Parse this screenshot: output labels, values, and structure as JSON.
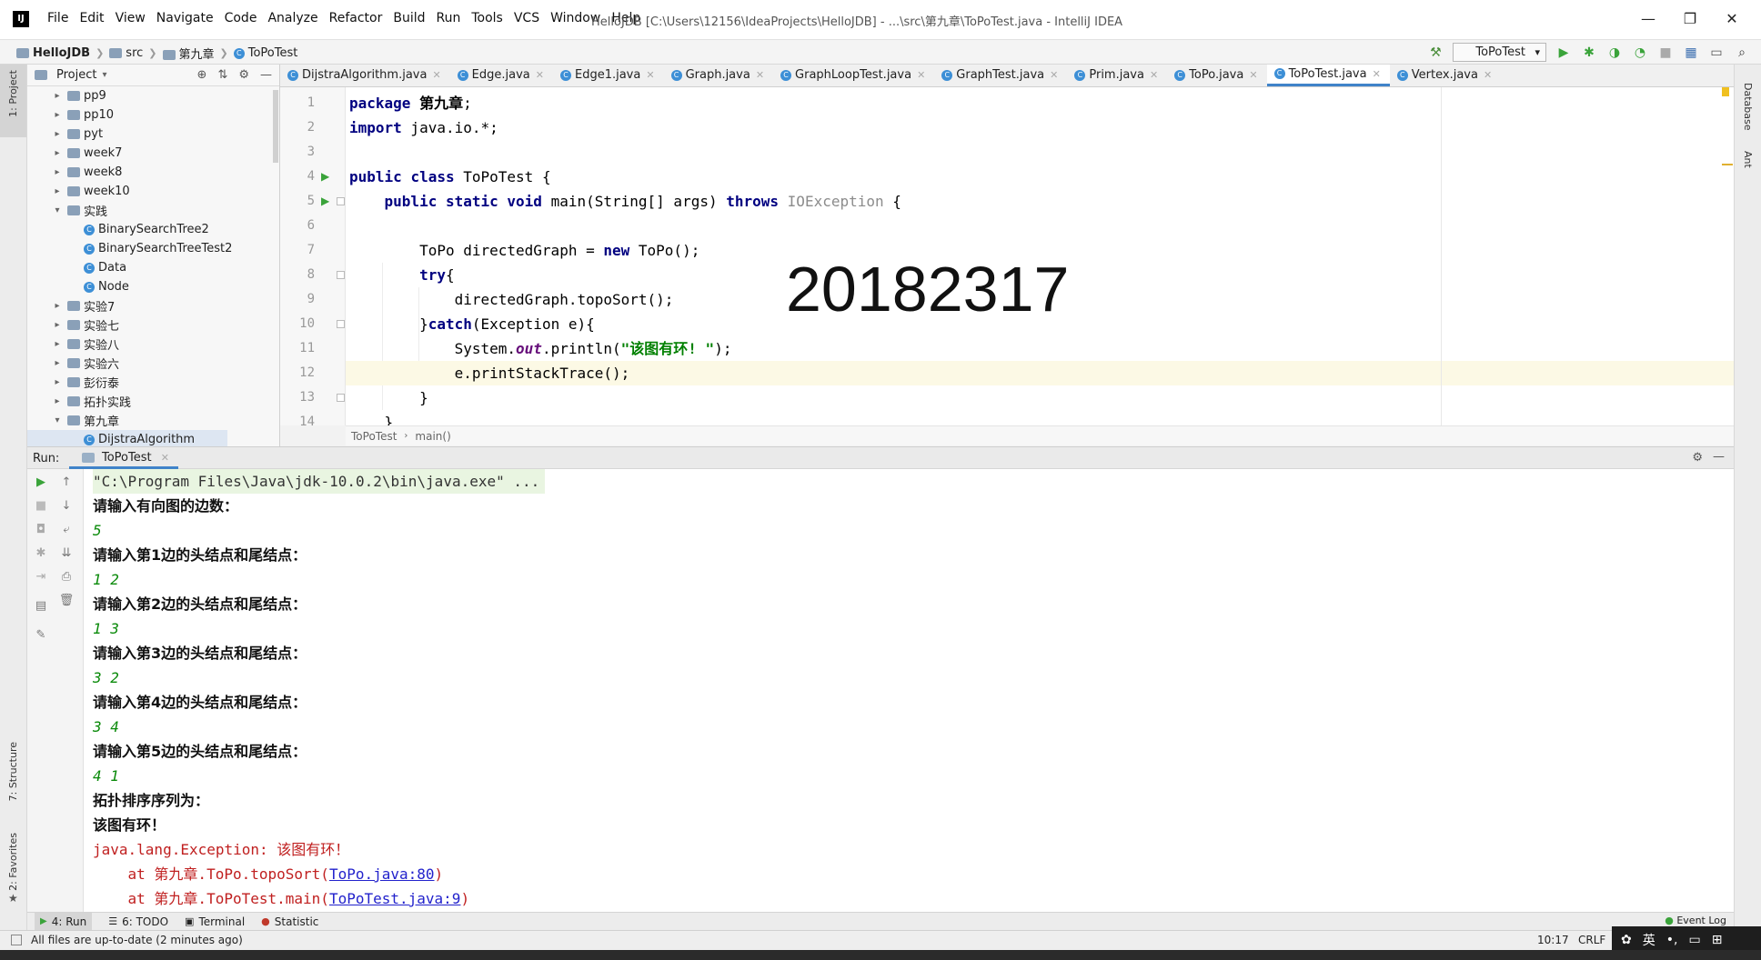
{
  "window": {
    "app_icon": "IJ",
    "title": "HelloJDB [C:\\Users\\12156\\IdeaProjects\\HelloJDB] - ...\\src\\第九章\\ToPoTest.java - IntelliJ IDEA",
    "controls": [
      "—",
      "❐",
      "✕"
    ]
  },
  "menu": [
    "File",
    "Edit",
    "View",
    "Navigate",
    "Code",
    "Analyze",
    "Refactor",
    "Build",
    "Run",
    "Tools",
    "VCS",
    "Window",
    "Help"
  ],
  "nav": {
    "crumbs": [
      "HelloJDB",
      "src",
      "第九章",
      "ToPoTest"
    ],
    "run_config": "ToPoTest"
  },
  "left_strip": {
    "project": "1: Project",
    "structure": "7: Structure",
    "favorites": "2: Favorites"
  },
  "right_strip": {
    "database": "Database",
    "ant": "Ant"
  },
  "project_panel": {
    "title": "Project",
    "items": [
      {
        "label": "pp9",
        "kind": "folder",
        "level": 1,
        "expanded": false
      },
      {
        "label": "pp10",
        "kind": "folder",
        "level": 1,
        "expanded": false
      },
      {
        "label": "pyt",
        "kind": "folder",
        "level": 1,
        "expanded": false
      },
      {
        "label": "week7",
        "kind": "folder",
        "level": 1,
        "expanded": false
      },
      {
        "label": "week8",
        "kind": "folder",
        "level": 1,
        "expanded": false
      },
      {
        "label": "week10",
        "kind": "folder",
        "level": 1,
        "expanded": false
      },
      {
        "label": "实践",
        "kind": "folder",
        "level": 1,
        "expanded": true
      },
      {
        "label": "BinarySearchTree2",
        "kind": "class",
        "level": 2
      },
      {
        "label": "BinarySearchTreeTest2",
        "kind": "class",
        "level": 2
      },
      {
        "label": "Data",
        "kind": "class",
        "level": 2
      },
      {
        "label": "Node",
        "kind": "class",
        "level": 2
      },
      {
        "label": "实验7",
        "kind": "folder",
        "level": 1,
        "expanded": false
      },
      {
        "label": "实验七",
        "kind": "folder",
        "level": 1,
        "expanded": false
      },
      {
        "label": "实验八",
        "kind": "folder",
        "level": 1,
        "expanded": false
      },
      {
        "label": "实验六",
        "kind": "folder",
        "level": 1,
        "expanded": false
      },
      {
        "label": "彭衍泰",
        "kind": "folder",
        "level": 1,
        "expanded": false
      },
      {
        "label": "拓扑实践",
        "kind": "folder",
        "level": 1,
        "expanded": false
      },
      {
        "label": "第九章",
        "kind": "folder",
        "level": 1,
        "expanded": true
      },
      {
        "label": "DijstraAlgorithm",
        "kind": "class",
        "level": 2
      }
    ]
  },
  "editor_tabs": [
    {
      "label": "DijstraAlgorithm.java",
      "active": false
    },
    {
      "label": "Edge.java",
      "active": false
    },
    {
      "label": "Edge1.java",
      "active": false
    },
    {
      "label": "Graph.java",
      "active": false
    },
    {
      "label": "GraphLoopTest.java",
      "active": false
    },
    {
      "label": "GraphTest.java",
      "active": false
    },
    {
      "label": "Prim.java",
      "active": false
    },
    {
      "label": "ToPo.java",
      "active": false
    },
    {
      "label": "ToPoTest.java",
      "active": true
    },
    {
      "label": "Vertex.java",
      "active": false
    }
  ],
  "code": {
    "line_numbers": [
      "1",
      "2",
      "3",
      "4",
      "5",
      "6",
      "7",
      "8",
      "9",
      "10",
      "11",
      "12",
      "13",
      "14"
    ],
    "lines": [
      "package 第九章;",
      "import java.io.*;",
      "",
      "public class ToPoTest {",
      "    public static void main(String[] args) throws IOException {",
      "",
      "        ToPo directedGraph = new ToPo();",
      "        try{",
      "            directedGraph.topoSort();",
      "        }catch(Exception e){",
      "            System.out.println(\"该图有环! \");",
      "            e.printStackTrace();",
      "        }",
      "    }"
    ],
    "highlight_line": 12
  },
  "watermark": "20182317",
  "editor_breadcrumb": [
    "ToPoTest",
    "main()"
  ],
  "run_panel": {
    "label": "Run:",
    "tab": "ToPoTest",
    "output": [
      {
        "kind": "cmd",
        "text": "\"C:\\Program Files\\Java\\jdk-10.0.2\\bin\\java.exe\" ..."
      },
      {
        "kind": "prompt",
        "text": "请输入有向图的边数："
      },
      {
        "kind": "input",
        "text": "5"
      },
      {
        "kind": "prompt",
        "text": "请输入第1边的头结点和尾结点："
      },
      {
        "kind": "input",
        "text": "1 2"
      },
      {
        "kind": "prompt",
        "text": "请输入第2边的头结点和尾结点："
      },
      {
        "kind": "input",
        "text": "1 3"
      },
      {
        "kind": "prompt",
        "text": "请输入第3边的头结点和尾结点："
      },
      {
        "kind": "input",
        "text": "3 2"
      },
      {
        "kind": "prompt",
        "text": "请输入第4边的头结点和尾结点："
      },
      {
        "kind": "input",
        "text": "3 4"
      },
      {
        "kind": "prompt",
        "text": "请输入第5边的头结点和尾结点："
      },
      {
        "kind": "input",
        "text": "4 1"
      },
      {
        "kind": "prompt",
        "text": "拓扑排序序列为："
      },
      {
        "kind": "prompt",
        "text": "该图有环！"
      },
      {
        "kind": "err",
        "text": "java.lang.Exception: 该图有环！"
      }
    ],
    "trace": [
      {
        "prefix": "    at 第九章.ToPo.topoSort(",
        "link": "ToPo.java:80",
        "suffix": ")"
      },
      {
        "prefix": "    at 第九章.ToPoTest.main(",
        "link": "ToPoTest.java:9",
        "suffix": ")"
      }
    ]
  },
  "bottom_tabs": [
    "4: Run",
    "6: TODO",
    "Terminal",
    "Statistic"
  ],
  "event_log": "Event Log",
  "status": {
    "message": "All files are up-to-date (2 minutes ago)",
    "position": "10:17",
    "line_sep": "CRLF"
  },
  "tray": {
    "ime": "英"
  },
  "colors": {
    "accent": "#4083c9",
    "keyword": "#000080",
    "string": "#008000",
    "error": "#c02020",
    "input": "#0a8a0a",
    "highlight": "#fcf9e5"
  }
}
